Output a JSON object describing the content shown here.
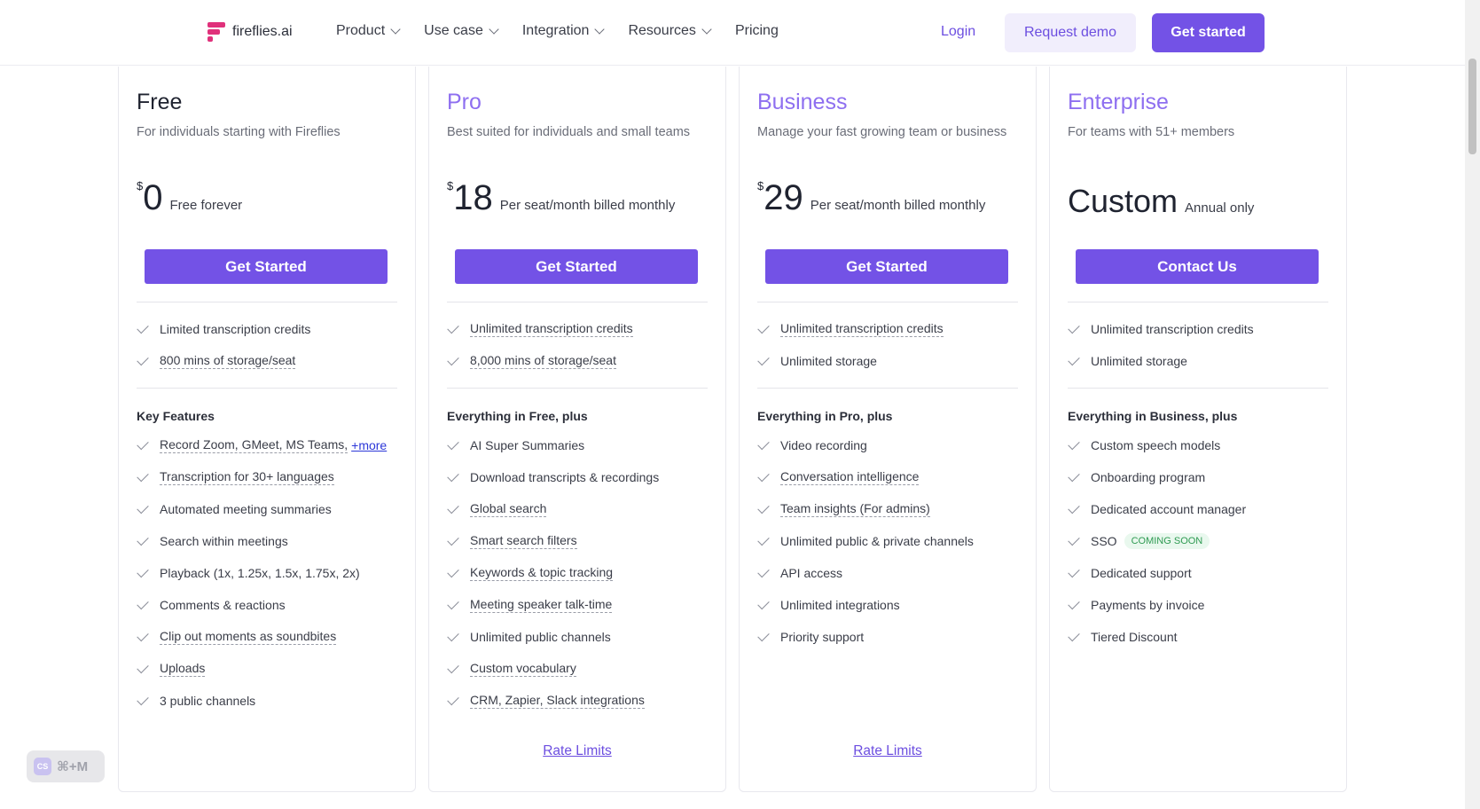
{
  "header": {
    "logo_text": "fireflies.ai",
    "nav": [
      {
        "label": "Product",
        "dropdown": true
      },
      {
        "label": "Use case",
        "dropdown": true
      },
      {
        "label": "Integration",
        "dropdown": true
      },
      {
        "label": "Resources",
        "dropdown": true
      },
      {
        "label": "Pricing",
        "dropdown": false
      }
    ],
    "login": "Login",
    "request_demo": "Request demo",
    "get_started": "Get started"
  },
  "colors": {
    "accent": "#7352e6",
    "brand_logo": "#e0317b",
    "link": "#2c37d8"
  },
  "plans": [
    {
      "name": "Free",
      "name_color": "#1f2330",
      "description": "For individuals starting with Fireflies",
      "currency": "$",
      "price": "0",
      "price_note": "Free forever",
      "cta": "Get Started",
      "highlights": [
        "Limited transcription credits",
        "800 mins of storage/seat"
      ],
      "section_title": "Key Features",
      "features": [
        "Record Zoom, GMeet, MS Teams,",
        "Transcription for 30+ languages",
        "Automated meeting summaries",
        "Search within meetings",
        "Playback (1x, 1.25x, 1.5x, 1.75x, 2x)",
        "Comments & reactions",
        "Clip out moments as soundbites",
        "Uploads",
        "3 public channels"
      ],
      "more_link": "+more"
    },
    {
      "name": "Pro",
      "name_color": "#8e6ff0",
      "description": "Best suited for individuals and small teams",
      "currency": "$",
      "price": "18",
      "price_note": "Per seat/month billed monthly",
      "cta": "Get Started",
      "highlights": [
        "Unlimited transcription credits",
        "8,000 mins of storage/seat"
      ],
      "section_title": "Everything in Free, plus",
      "features": [
        "AI Super Summaries",
        "Download transcripts & recordings",
        "Global search",
        "Smart search filters",
        "Keywords & topic tracking",
        "Meeting speaker talk-time",
        "Unlimited public channels",
        "Custom vocabulary",
        "CRM, Zapier, Slack integrations"
      ],
      "rate_limits": "Rate Limits"
    },
    {
      "name": "Business",
      "name_color": "#8e6ff0",
      "description": "Manage your fast growing team or business",
      "currency": "$",
      "price": "29",
      "price_note": "Per seat/month billed monthly",
      "cta": "Get Started",
      "highlights": [
        "Unlimited transcription credits",
        "Unlimited storage"
      ],
      "section_title": "Everything in Pro, plus",
      "features": [
        "Video recording",
        "Conversation intelligence",
        "Team insights (For admins)",
        "Unlimited public & private channels",
        "API access",
        "Unlimited integrations",
        "Priority support"
      ],
      "rate_limits": "Rate Limits"
    },
    {
      "name": "Enterprise",
      "name_color": "#8e6ff0",
      "description": "For teams with 51+ members",
      "price": "Custom",
      "price_note": "Annual only",
      "cta": "Contact Us",
      "highlights": [
        "Unlimited transcription credits",
        "Unlimited storage"
      ],
      "section_title": "Everything in Business, plus",
      "features": [
        "Custom speech models",
        "Onboarding program",
        "Dedicated account manager",
        "SSO",
        "Dedicated support",
        "Payments by invoice",
        "Tiered Discount"
      ],
      "badge": "COMING SOON"
    }
  ],
  "widget": {
    "icon_text": "CS",
    "shortcut": "⌘+M"
  }
}
